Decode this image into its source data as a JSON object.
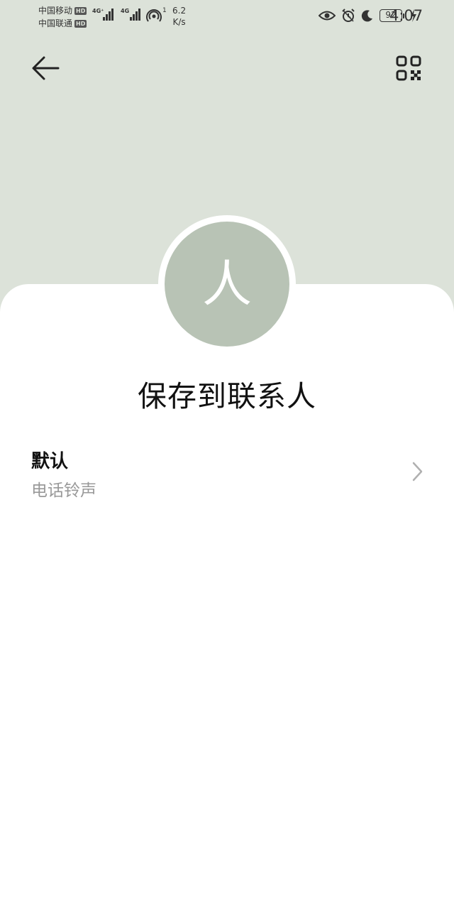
{
  "status_bar": {
    "carrier_1": "中国移动",
    "carrier_2": "中国联通",
    "hd": "HD",
    "net_1": "4G⁺",
    "net_2": "4G",
    "hotspot_count": "1",
    "speed_value": "6.2",
    "speed_unit": "K/s",
    "battery": "92",
    "time": "4:07",
    "icons": [
      "eye-icon",
      "alarm-icon",
      "moon-icon",
      "charging-icon"
    ]
  },
  "toolbar": {
    "back_icon": "arrow-left-icon",
    "qr_icon": "qr-code-icon"
  },
  "contact": {
    "avatar_glyph": "人",
    "save_label": "保存到联系人",
    "avatar_color": "#b8c3b5"
  },
  "ringtone": {
    "value": "默认",
    "label": "电话铃声"
  },
  "colors": {
    "header_bg": "#dce2d9",
    "card_bg": "#ffffff",
    "secondary_text": "#999999"
  }
}
